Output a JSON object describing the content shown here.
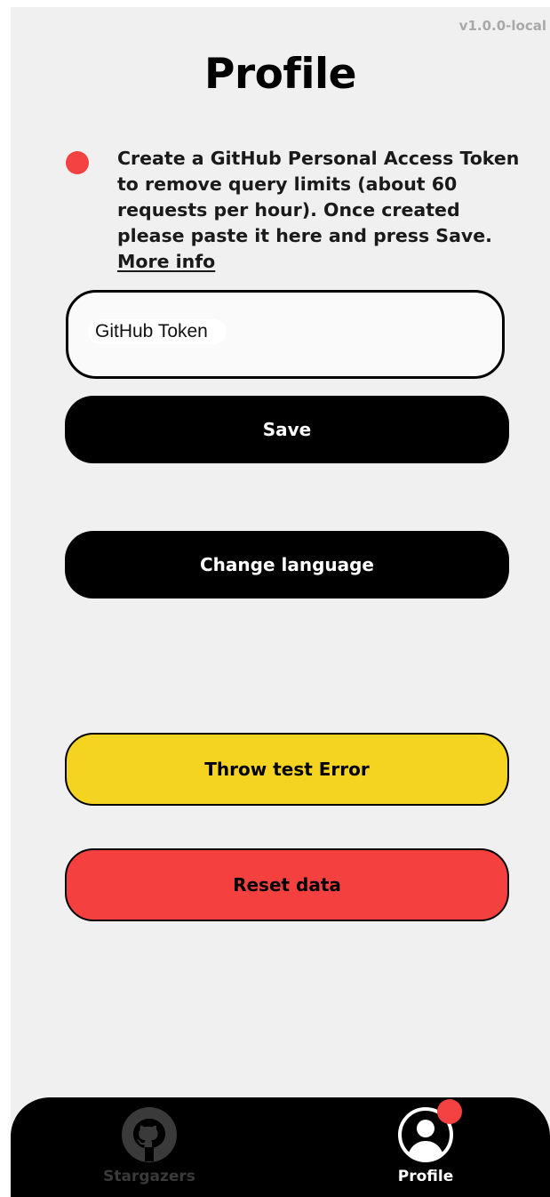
{
  "app": {
    "version": "v1.0.0-local"
  },
  "page": {
    "title": "Profile"
  },
  "notice": {
    "text": "Create a GitHub Personal Access Token to remove query limits (about 60 requests per hour). Once created please paste it here and press Save.",
    "link_label": "More info",
    "indicator_color": "#f44242"
  },
  "token": {
    "placeholder": "GitHub Token",
    "value": ""
  },
  "buttons": {
    "save": "Save",
    "change_language": "Change language",
    "throw_error": "Throw test Error",
    "reset_data": "Reset data"
  },
  "colors": {
    "background": "#f0f0f0",
    "primary_button": "#000000",
    "warning_button": "#f5d421",
    "danger_button": "#f54040",
    "badge": "#f44242"
  },
  "tabbar": {
    "tabs": [
      {
        "label": "Stargazers",
        "icon": "github-icon",
        "active": false
      },
      {
        "label": "Profile",
        "icon": "profile-icon",
        "active": true,
        "badge": true
      }
    ]
  }
}
